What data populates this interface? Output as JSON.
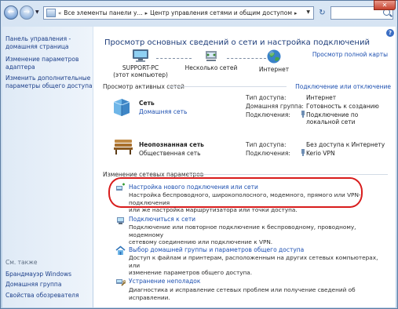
{
  "address": {
    "root_label": "Все элементы панели у...",
    "current_label": "Центр управления сетями и общим доступом"
  },
  "search": {
    "placeholder": ""
  },
  "sidebar": {
    "home_link": [
      "Панель управления -",
      "домашняя страница"
    ],
    "adapter_link": [
      "Изменение параметров",
      "адаптера"
    ],
    "sharing_link": [
      "Изменить дополнительные",
      "параметры общего доступа"
    ],
    "see_also": "См. также",
    "see_also_items": [
      "Брандмауэр Windows",
      "Домашняя группа",
      "Свойства обозревателя"
    ]
  },
  "main": {
    "title": "Просмотр основных сведений о сети и настройка подключений",
    "full_map_link": "Просмотр полной карты",
    "map": {
      "computer_name": "SUPPORT-PC",
      "computer_sub": "(этот компьютер)",
      "middle_label": "Несколько сетей",
      "internet_label": "Интернет"
    },
    "active_networks_header": "Просмотр активных сетей",
    "connect_disconnect_link": "Подключение или отключение",
    "networks": [
      {
        "name": "Сеть",
        "type_link": "Домашняя сеть",
        "access_label": "Тип доступа:",
        "access_value": "Интернет",
        "homegroup_label": "Домашняя группа:",
        "homegroup_value": "Готовность к созданию",
        "connections_label": "Подключения:",
        "connections_value": [
          "Подключение по",
          "локальной сети"
        ]
      },
      {
        "name": "Неопознанная сеть",
        "type_text": "Общественная сеть",
        "access_label": "Тип доступа:",
        "access_value": "Без доступа к Интернету",
        "connections_label": "Подключения:",
        "connections_value": "Kerio VPN"
      }
    ],
    "change_settings_header": "Изменение сетевых параметров",
    "tasks": [
      {
        "title": "Настройка нового подключения или сети",
        "desc": [
          "Настройка беспроводного, широкополосного, модемного, прямого или VPN-подключения",
          "или же настройка маршрутизатора или точки доступа."
        ]
      },
      {
        "title": "Подключиться к сети",
        "desc": [
          "Подключение или повторное подключение к беспроводному, проводному, модемному",
          "сетевому соединению или подключение к VPN."
        ]
      },
      {
        "title": "Выбор домашней группы и параметров общего доступа",
        "desc": [
          "Доступ к файлам и принтерам, расположенным на других сетевых компьютерах, или",
          "изменение параметров общего доступа."
        ]
      },
      {
        "title": "Устранение неполадок",
        "desc": [
          "Диагностика и исправление сетевых проблем или получение сведений об исправлении."
        ]
      }
    ]
  },
  "colors": {
    "link": "#1c4fb0",
    "highlight": "#d81c1c",
    "sidebar_bg": "#dfeaf6"
  }
}
